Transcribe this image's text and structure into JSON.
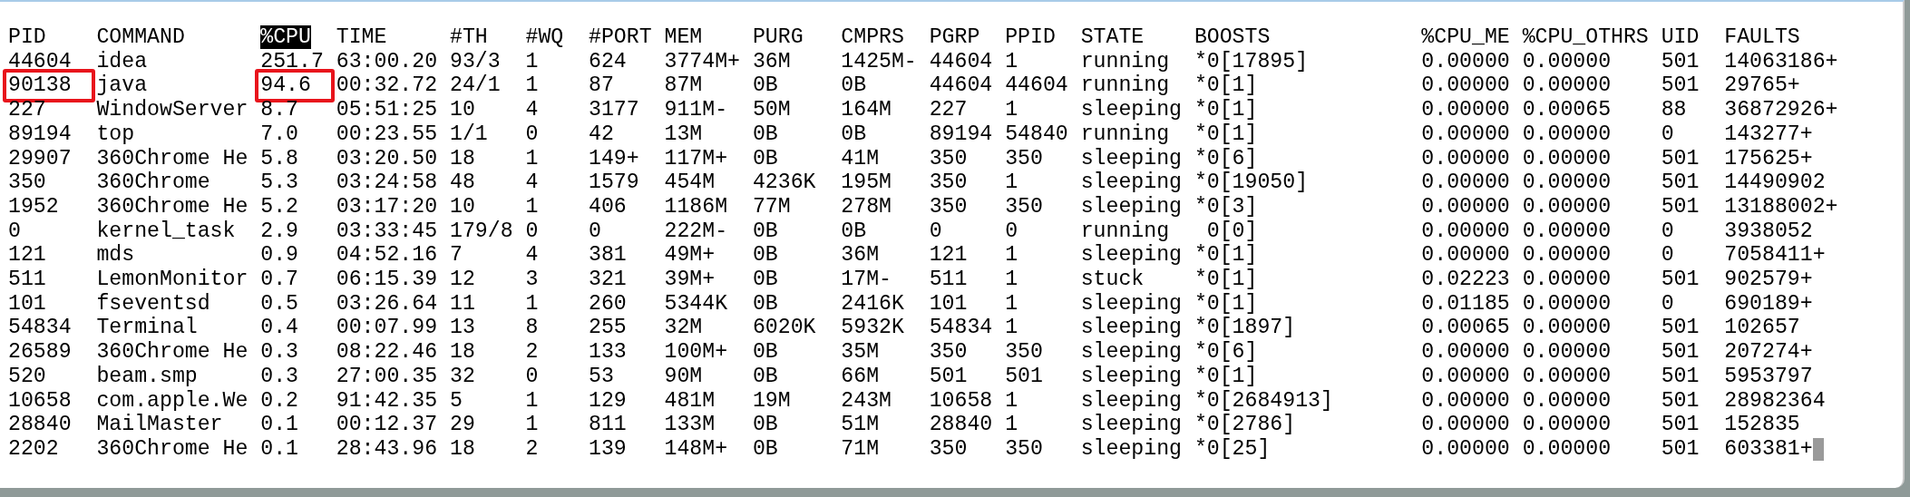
{
  "columns": [
    {
      "label": "PID",
      "sorted": false
    },
    {
      "label": "COMMAND",
      "sorted": false
    },
    {
      "label": "%CPU",
      "sorted": true
    },
    {
      "label": "TIME",
      "sorted": false
    },
    {
      "label": "#TH",
      "sorted": false
    },
    {
      "label": "#WQ",
      "sorted": false
    },
    {
      "label": "#PORT",
      "sorted": false
    },
    {
      "label": "MEM",
      "sorted": false
    },
    {
      "label": "PURG",
      "sorted": false
    },
    {
      "label": "CMPRS",
      "sorted": false
    },
    {
      "label": "PGRP",
      "sorted": false
    },
    {
      "label": "PPID",
      "sorted": false
    },
    {
      "label": "STATE",
      "sorted": false
    },
    {
      "label": "BOOSTS",
      "sorted": false
    },
    {
      "label": "%CPU_ME",
      "sorted": false
    },
    {
      "label": "%CPU_OTHRS",
      "sorted": false
    },
    {
      "label": "UID",
      "sorted": false
    },
    {
      "label": "FAULTS",
      "sorted": false
    }
  ],
  "rows": [
    {
      "cells": [
        "44604",
        "idea",
        "251.7",
        "63:00.20",
        "93/3",
        "1",
        "624",
        "3774M+",
        "36M",
        "1425M-",
        "44604",
        "1",
        "running",
        "*0[17895]",
        "0.00000",
        "0.00000",
        "501",
        "14063186+"
      ]
    },
    {
      "cells": [
        {
          "text": "90138",
          "boxed": true
        },
        "java",
        {
          "text": "94.6",
          "boxed": true
        },
        "00:32.72",
        "24/1",
        "1",
        "87",
        "87M",
        "0B",
        "0B",
        "44604",
        "44604",
        "running",
        "*0[1]",
        "0.00000",
        "0.00000",
        "501",
        "29765+"
      ]
    },
    {
      "cells": [
        "227",
        "WindowServer",
        "8.7",
        "05:51:25",
        "10",
        "4",
        "3177",
        "911M-",
        "50M",
        "164M",
        "227",
        "1",
        "sleeping",
        "*0[1]",
        "0.00000",
        "0.00065",
        "88",
        "36872926+"
      ]
    },
    {
      "cells": [
        "89194",
        "top",
        "7.0",
        "00:23.55",
        "1/1",
        "0",
        "42",
        "13M",
        "0B",
        "0B",
        "89194",
        "54840",
        "running",
        "*0[1]",
        "0.00000",
        "0.00000",
        "0",
        "143277+"
      ]
    },
    {
      "cells": [
        "29907",
        "360Chrome He",
        "5.8",
        "03:20.50",
        "18",
        "1",
        "149+",
        "117M+",
        "0B",
        "41M",
        "350",
        "350",
        "sleeping",
        "*0[6]",
        "0.00000",
        "0.00000",
        "501",
        "175625+"
      ]
    },
    {
      "cells": [
        "350",
        "360Chrome",
        "5.3",
        "03:24:58",
        "48",
        "4",
        "1579",
        "454M",
        "4236K",
        "195M",
        "350",
        "1",
        "sleeping",
        "*0[19050]",
        "0.00000",
        "0.00000",
        "501",
        "14490902"
      ]
    },
    {
      "cells": [
        "1952",
        "360Chrome He",
        "5.2",
        "03:17:20",
        "10",
        "1",
        "406",
        "1186M",
        "77M",
        "278M",
        "350",
        "350",
        "sleeping",
        "*0[3]",
        "0.00000",
        "0.00000",
        "501",
        "13188002+"
      ]
    },
    {
      "cells": [
        "0",
        "kernel_task",
        "2.9",
        "03:33:45",
        "179/8",
        "0",
        "0",
        "222M-",
        "0B",
        "0B",
        "0",
        "0",
        "running",
        " 0[0]",
        "0.00000",
        "0.00000",
        "0",
        "3938052"
      ]
    },
    {
      "cells": [
        "121",
        "mds",
        "0.9",
        "04:52.16",
        "7",
        "4",
        "381",
        "49M+",
        "0B",
        "36M",
        "121",
        "1",
        "sleeping",
        "*0[1]",
        "0.00000",
        "0.00000",
        "0",
        "7058411+"
      ]
    },
    {
      "cells": [
        "511",
        "LemonMonitor",
        "0.7",
        "06:15.39",
        "12",
        "3",
        "321",
        "39M+",
        "0B",
        "17M-",
        "511",
        "1",
        "stuck",
        "*0[1]",
        "0.02223",
        "0.00000",
        "501",
        "902579+"
      ]
    },
    {
      "cells": [
        "101",
        "fseventsd",
        "0.5",
        "03:26.64",
        "11",
        "1",
        "260",
        "5344K",
        "0B",
        "2416K",
        "101",
        "1",
        "sleeping",
        "*0[1]",
        "0.01185",
        "0.00000",
        "0",
        "690189+"
      ]
    },
    {
      "cells": [
        "54834",
        "Terminal",
        "0.4",
        "00:07.99",
        "13",
        "8",
        "255",
        "32M",
        "6020K",
        "5932K",
        "54834",
        "1",
        "sleeping",
        "*0[1897]",
        "0.00065",
        "0.00000",
        "501",
        "102657"
      ]
    },
    {
      "cells": [
        "26589",
        "360Chrome He",
        "0.3",
        "08:22.46",
        "18",
        "2",
        "133",
        "100M+",
        "0B",
        "35M",
        "350",
        "350",
        "sleeping",
        "*0[6]",
        "0.00000",
        "0.00000",
        "501",
        "207274+"
      ]
    },
    {
      "cells": [
        "520",
        "beam.smp",
        "0.3",
        "27:00.35",
        "32",
        "0",
        "53",
        "90M",
        "0B",
        "66M",
        "501",
        "501",
        "sleeping",
        "*0[1]",
        "0.00000",
        "0.00000",
        "501",
        "5953797"
      ]
    },
    {
      "cells": [
        "10658",
        "com.apple.We",
        "0.2",
        "91:42.35",
        "5",
        "1",
        "129",
        "481M",
        "19M",
        "243M",
        "10658",
        "1",
        "sleeping",
        "*0[2684913]",
        "0.00000",
        "0.00000",
        "501",
        "28982364"
      ]
    },
    {
      "cells": [
        "28840",
        "MailMaster",
        "0.1",
        "00:12.37",
        "29",
        "1",
        "811",
        "133M",
        "0B",
        "51M",
        "28840",
        "1",
        "sleeping",
        "*0[2786]",
        "0.00000",
        "0.00000",
        "501",
        "152835"
      ]
    },
    {
      "cells": [
        "2202",
        "360Chrome He",
        "0.1",
        "28:43.96",
        "18",
        "2",
        "139",
        "148M+",
        "0B",
        "71M",
        "350",
        "350",
        "sleeping",
        "*0[25]",
        "0.00000",
        "0.00000",
        "501",
        "603381+"
      ]
    }
  ]
}
